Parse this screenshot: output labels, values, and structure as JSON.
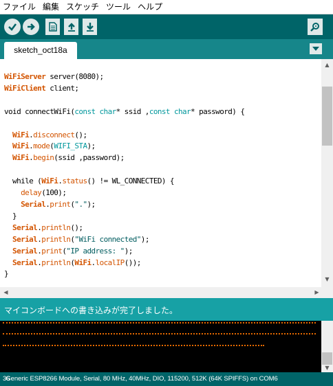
{
  "menu": [
    "ファイル",
    "編集",
    "スケッチ",
    "ツール",
    "ヘルプ"
  ],
  "toolbar": {
    "verify_icon": "checkmark-icon",
    "upload_icon": "arrow-right-icon",
    "new_icon": "new-document-icon",
    "open_icon": "arrow-up-icon",
    "save_icon": "arrow-down-icon",
    "serial_monitor_icon": "magnifier-icon"
  },
  "tab": {
    "label": "sketch_oct18a",
    "menu_icon": "triangle-down-icon"
  },
  "code": {
    "l1": [
      "WiFiServer",
      " server(8080);"
    ],
    "l2": [
      "WiFiClient",
      " client;"
    ],
    "l4": [
      "void connectWiFi(",
      "const char",
      "* ssid ,",
      "const char",
      "* password) {"
    ],
    "l6": [
      "WiFi",
      ".",
      "disconnect",
      "();"
    ],
    "l7": [
      "WiFi",
      ".",
      "mode",
      "(",
      "WIFI_STA",
      ");"
    ],
    "l8": [
      "WiFi",
      ".",
      "begin",
      "(ssid ,password);"
    ],
    "l10": [
      "while (",
      "WiFi",
      ".",
      "status",
      "() != WL_CONNECTED) {"
    ],
    "l11": [
      "delay",
      "(100);"
    ],
    "l12": [
      "Serial",
      ".",
      "print",
      "(",
      "\".\"",
      ");"
    ],
    "l13": [
      "}"
    ],
    "l14": [
      "Serial",
      ".",
      "println",
      "();"
    ],
    "l15": [
      "Serial",
      ".",
      "println",
      "(",
      "\"WiFi connected\"",
      ");"
    ],
    "l16": [
      "Serial",
      ".",
      "print",
      "(",
      "\"IP address: \"",
      ");"
    ],
    "l17": [
      "Serial",
      ".",
      "println",
      "(",
      "WiFi",
      ".",
      "localIP",
      "());"
    ],
    "l18": [
      "}"
    ]
  },
  "status": {
    "message": "マイコンボードへの書き込みが完了しました。"
  },
  "footer": {
    "line_number": "36",
    "board_info": "Generic ESP8266 Module, Serial, 80 MHz, 40MHz, DIO, 115200, 512K (64K SPIFFS) on COM6"
  },
  "colors": {
    "toolbar": "#006468",
    "tabbar": "#16868a",
    "status": "#17a1a5",
    "console_text": "#e76a00",
    "keyword": "#d35400",
    "type": "#00979c"
  }
}
